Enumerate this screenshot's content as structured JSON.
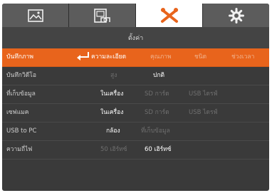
{
  "tabs": [
    {
      "icon": "image-icon"
    },
    {
      "icon": "camera-photo-icon"
    },
    {
      "icon": "tools-icon"
    },
    {
      "icon": "gear-icon"
    }
  ],
  "header": {
    "title": "ตั้งค่า"
  },
  "rows": [
    {
      "label": "บันทึกภาพ",
      "options": [
        "ความละเอียด",
        "คุณภาพ",
        "ชนิด",
        "ช่วงเวลา"
      ]
    },
    {
      "label": "บันทึกวิดีโอ",
      "options": [
        "สูง",
        "ปกติ"
      ]
    },
    {
      "label": "ที่เก็บข้อมูล",
      "options": [
        "ในเครื่อง",
        "SD การ์ด",
        "USB ไดรฟ์"
      ]
    },
    {
      "label": "เซฟแมค",
      "options": [
        "ในเครื่อง",
        "SD การ์ด",
        "USB ไดรฟ์"
      ]
    },
    {
      "label": "USB to PC",
      "options": [
        "กล้อง",
        "ที่เก็บข้อมูล"
      ]
    },
    {
      "label": "ความถี่ไฟ",
      "options": [
        "50 เฮิร์ทซ์",
        "60 เฮิร์ทซ์"
      ]
    }
  ],
  "colors": {
    "accent": "#e8641c",
    "panel": "#3a3a3a",
    "tabbar": "#5c5c5c"
  }
}
